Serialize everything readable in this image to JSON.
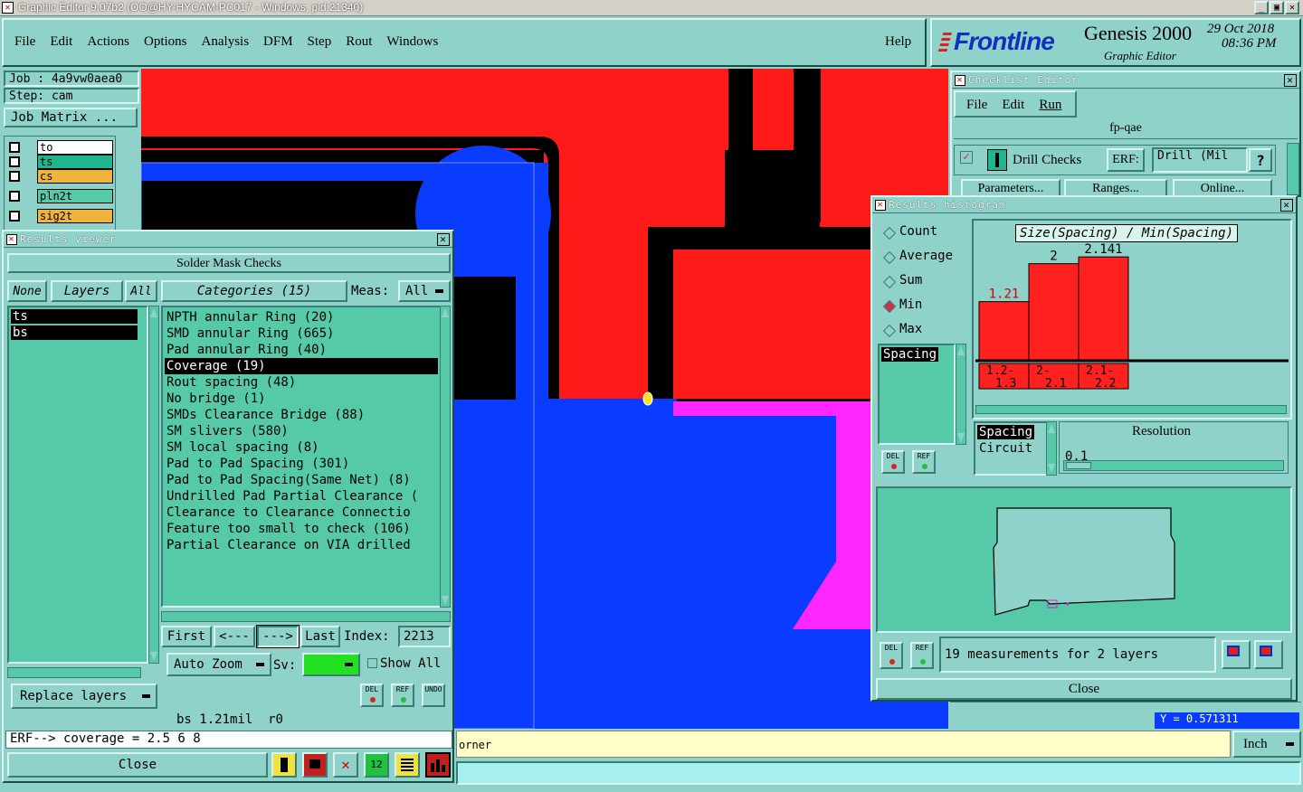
{
  "window": {
    "title": "Graphic Editor 9.07b2 (OO@HY-HYCAM-PC017 - Windows, pid:21340)",
    "min": "_",
    "max": "▣",
    "close": "✕"
  },
  "menu": [
    "File",
    "Edit",
    "Actions",
    "Options",
    "Analysis",
    "DFM",
    "Step",
    "Rout",
    "Windows"
  ],
  "help": "Help",
  "brand": {
    "logo": "Frontline",
    "product": "Genesis 2000",
    "sub": "Graphic Editor",
    "date": "29 Oct 2018",
    "time": "08:36 PM"
  },
  "job": {
    "job": "Job : 4a9vw0aea0",
    "step": "Step: cam",
    "matrix": "Job Matrix ..."
  },
  "layers": [
    {
      "name": "to",
      "color": "#ffffff"
    },
    {
      "name": "ts",
      "color": "#1fb58f"
    },
    {
      "name": "cs",
      "color": "#f0b43c"
    },
    {
      "name": "pln2t",
      "color": "#56c9a8"
    },
    {
      "name": "sig2t",
      "color": "#f0b43c"
    }
  ],
  "results": {
    "title": "Results viewer",
    "header": "Solder Mask Checks",
    "none": "None",
    "layers_btn": "Layers",
    "all": "All",
    "categories_label": "Categories (15)",
    "meas_label": "Meas:",
    "meas_value": "All",
    "layer_list": [
      "ts",
      "bs"
    ],
    "categories": [
      "NPTH annular Ring (20)",
      "SMD annular Ring (665)",
      "Pad annular Ring (40)",
      "Coverage (19)",
      "Rout spacing (48)",
      "No bridge (1)",
      "SMDs Clearance Bridge (88)",
      "SM slivers (580)",
      "SM local spacing (8)",
      "Pad to Pad Spacing (301)",
      "Pad to Pad Spacing(Same Net) (8)",
      "Undrilled Pad Partial Clearance (",
      "Clearance to Clearance Connectio",
      "Feature too small to check (106)",
      "Partial Clearance on VIA drilled"
    ],
    "selected_category": "Coverage (19)",
    "first": "First",
    "prev": "<---",
    "next": "--->",
    "last": "Last",
    "index_label": "Index:",
    "index_value": "2213",
    "autozoom": "Auto Zoom",
    "sv_label": "Sv:",
    "show_all": "Show All",
    "replace": "Replace layers",
    "del": "DEL",
    "ref": "REF",
    "undo": "UNDO",
    "status": "bs 1.21mil  r0",
    "erf": "ERF--> coverage = 2.5 6 8",
    "close": "Close"
  },
  "checklist": {
    "title": "Checklist Editor",
    "menu": [
      "File",
      "Edit",
      "Run"
    ],
    "name": "fp-qae",
    "check": "Drill Checks",
    "erf_label": "ERF:",
    "erf_value": "Drill (Mil",
    "help": "?",
    "params": "Parameters...",
    "ranges": "Ranges...",
    "online": "Online..."
  },
  "histogram": {
    "title": "Results histogram",
    "modes": [
      "Count",
      "Average",
      "Sum",
      "Min",
      "Max"
    ],
    "selected_mode": "Min",
    "plot_title": "Size(Spacing) / Min(Spacing)",
    "fields": [
      "Spacing"
    ],
    "selected_field": "Spacing",
    "types": [
      "Spacing",
      "Circuit"
    ],
    "resolution_label": "Resolution",
    "resolution_value": "0.1",
    "summary": "19 measurements for 2 layers",
    "close": "Close",
    "chart_data": {
      "type": "bar",
      "categories": [
        "1.2-1.3",
        "2-2.1",
        "2.1-2.2"
      ],
      "values": [
        1.21,
        2,
        2.141
      ],
      "value_labels": [
        "1.21",
        "2",
        "2.141"
      ],
      "title": "Size(Spacing) / Min(Spacing)",
      "ylim": [
        0,
        2.6
      ],
      "colors": {
        "bar": "#ff2020",
        "label_first": "#d00000"
      }
    }
  },
  "bottom": {
    "message": "orner",
    "units": "Inch",
    "coord": "Y = 0.571311"
  },
  "colors": {
    "bg": "#8fd2c9",
    "list": "#56c9a8",
    "red": "#ff1a1a",
    "blue": "#0a3cff",
    "magenta": "#ff26ff",
    "yellow": "#ffffc8"
  }
}
